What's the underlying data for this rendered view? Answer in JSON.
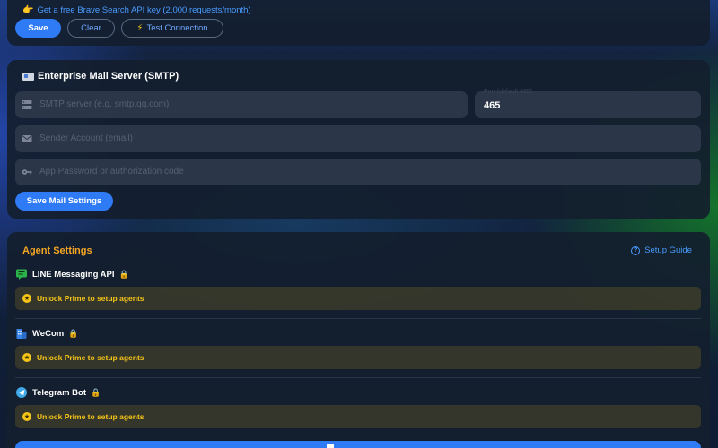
{
  "search_card": {
    "api_link_icon": "pointing-hand-icon",
    "api_link_text": "Get a free Brave Search API key (2,000 requests/month)",
    "save_label": "Save",
    "clear_label": "Clear",
    "test_label": "Test Connection",
    "test_icon": "lightning-icon"
  },
  "smtp": {
    "title": "Enterprise Mail Server (SMTP)",
    "title_icon": "mail-icon",
    "server_placeholder": "SMTP server (e.g. smtp.qq.com)",
    "server_icon": "server-icon",
    "port_label": "Port (default 465)",
    "port_value": "465",
    "account_placeholder": "Sender Account (email)",
    "account_icon": "mail-icon",
    "password_placeholder": "App Password or authorization code",
    "password_icon": "key-icon",
    "save_label": "Save Mail Settings"
  },
  "agents": {
    "title": "Agent Settings",
    "guide_label": "Setup Guide",
    "guide_icon": "help-circle-icon",
    "items": [
      {
        "label": "LINE Messaging API",
        "icon": "chat-icon",
        "icon_color": "#2bb34a",
        "locked": true,
        "unlock_text": "Unlock Prime to setup agents"
      },
      {
        "label": "WeCom",
        "icon": "building-icon",
        "icon_color": "#3a86e8",
        "locked": true,
        "unlock_text": "Unlock Prime to setup agents"
      },
      {
        "label": "Telegram Bot",
        "icon": "telegram-icon",
        "icon_color": "#3fa9e8",
        "locked": true,
        "unlock_text": "Unlock Prime to setup agents"
      }
    ]
  },
  "colors": {
    "accent": "#2f7bf5",
    "link": "#4a9bff",
    "warning": "#f5c518",
    "agent_title": "#f5a623"
  }
}
